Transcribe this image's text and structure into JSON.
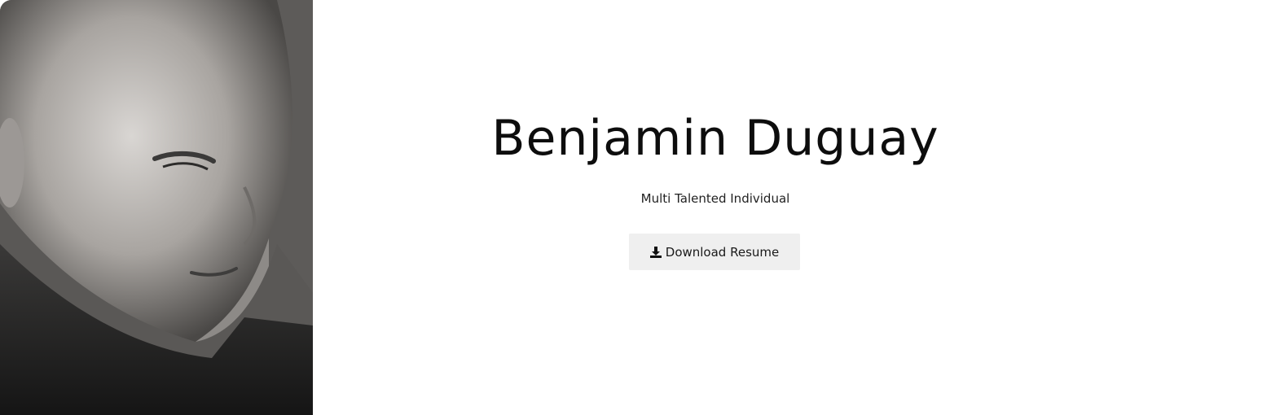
{
  "profile": {
    "portrait_icon": "portrait-photo",
    "name": "Benjamin Duguay",
    "tagline": "Multi Talented Individual"
  },
  "actions": {
    "download_label": "Download Resume",
    "download_icon": "download-icon"
  }
}
